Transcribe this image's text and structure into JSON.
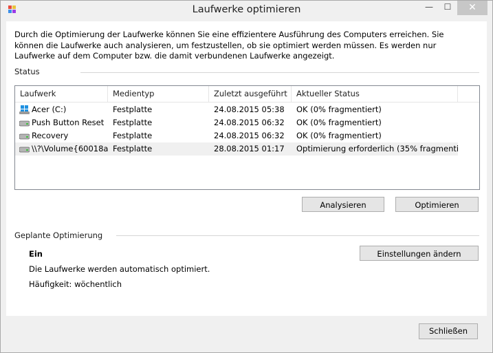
{
  "window": {
    "title": "Laufwerke optimieren",
    "min_glyph": "—",
    "max_glyph": "☐",
    "close_glyph": "✕"
  },
  "intro_text": "Durch die Optimierung der Laufwerke können Sie eine effizientere Ausführung des Computers erreichen. Sie können die Laufwerke auch analysieren, um festzustellen, ob sie optimiert werden müssen. Es werden nur Laufwerke auf dem Computer bzw. die damit verbundenen Laufwerke angezeigt.",
  "status": {
    "label": "Status",
    "columns": [
      "Laufwerk",
      "Medientyp",
      "Zuletzt ausgeführt",
      "Aktueller Status"
    ],
    "rows": [
      {
        "drive": "Acer (C:)",
        "icon": "windows-drive-icon",
        "media": "Festplatte",
        "last_run": "24.08.2015 05:38",
        "state": "OK (0% fragmentiert)"
      },
      {
        "drive": "Push Button Reset",
        "icon": "drive-icon",
        "media": "Festplatte",
        "last_run": "24.08.2015 06:32",
        "state": "OK (0% fragmentiert)"
      },
      {
        "drive": "Recovery",
        "icon": "drive-icon",
        "media": "Festplatte",
        "last_run": "24.08.2015 06:32",
        "state": "OK (0% fragmentiert)"
      },
      {
        "drive": "\\\\?\\Volume{60018a...",
        "icon": "drive-icon",
        "media": "Festplatte",
        "last_run": "28.08.2015 01:17",
        "state": "Optimierung erforderlich (35% fragmenti..."
      }
    ],
    "analyze_label": "Analysieren",
    "optimize_label": "Optimieren"
  },
  "scheduled": {
    "label": "Geplante Optimierung",
    "state": "Ein",
    "description": "Die Laufwerke werden automatisch optimiert.",
    "frequency": "Häufigkeit: wöchentlich",
    "change_settings_label": "Einstellungen ändern"
  },
  "close_label": "Schließen",
  "colors": {
    "window_bg": "#f0f0f0",
    "client_bg": "#ffffff",
    "button_bg": "#e5e5e5",
    "button_border": "#adadad",
    "selected_row": "#f0f0f0"
  }
}
